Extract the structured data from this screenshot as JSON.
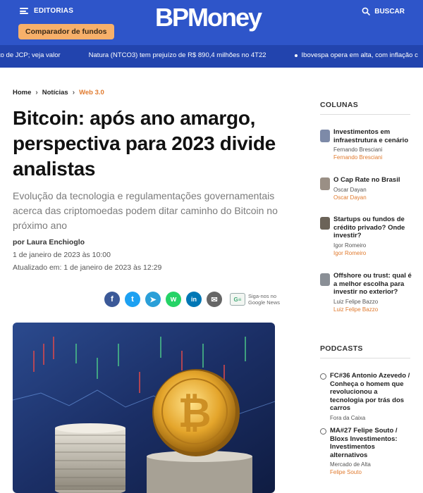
{
  "header": {
    "menu_label": "EDITORIAS",
    "logo_text": "BPMoney",
    "search_label": "BUSCAR",
    "comparador_label": "Comparador de fundos"
  },
  "ticker": {
    "items": [
      "to de JCP; veja valor",
      "Natura (NTCO3) tem prejuízo de R$ 890,4 milhões no 4T22",
      "Ibovespa opera em alta, com inflação c"
    ]
  },
  "breadcrumb": {
    "home": "Home",
    "section": "Notícias",
    "current": "Web 3.0"
  },
  "article": {
    "title": "Bitcoin: após ano amargo, perspectiva para 2023 divide analistas",
    "subtitle": "Evolução da tecnologia e regulamentações governamentais acerca das criptomoedas podem ditar caminho do Bitcoin no próximo ano",
    "author": "por Laura Enchioglo",
    "published": "1 de janeiro de 2023 às 10:00",
    "updated": "Atualizado em: 1 de janeiro de 2023 às 12:29"
  },
  "share": {
    "facebook": "f",
    "twitter": "t",
    "telegram": "➤",
    "whatsapp": "w",
    "linkedin": "in",
    "email": "✉",
    "google_news_box": "G≡",
    "google_news_line1": "Siga-nos no",
    "google_news_line2": "Google News"
  },
  "colunas": {
    "title": "COLUNAS",
    "items": [
      {
        "headline": "Investimentos em infraestrutura e cenário",
        "author": "Fernando Bresciani",
        "column": "Fernando Bresciani"
      },
      {
        "headline": "O Cap Rate no Brasil",
        "author": "Oscar Dayan",
        "column": "Oscar Dayan"
      },
      {
        "headline": "Startups ou fundos de crédito privado? Onde investir?",
        "author": "Igor Romeiro",
        "column": "Igor Romeiro"
      },
      {
        "headline": "Offshore ou trust: qual é a melhor escolha para investir no exterior?",
        "author": "Luiz Felipe Bazzo",
        "column": "Luiz Felipe Bazzo"
      }
    ]
  },
  "podcasts": {
    "title": "PODCASTS",
    "items": [
      {
        "headline": "FC#36 Antonio Azevedo / Conheça o homem que revolucionou a tecnologia por trás dos carros",
        "show": "Fora da Caixa"
      },
      {
        "headline": "MA#27 Felipe Souto / Bloxs Investimentos: Investimentos alternativos",
        "show": "Mercado de Alta",
        "guest": "Felipe Souto"
      }
    ]
  },
  "colors": {
    "header_blue": "#2e55c9",
    "ticker_blue": "#2244ae",
    "accent_orange": "#e07a2e",
    "button_orange": "#f7b06a"
  }
}
